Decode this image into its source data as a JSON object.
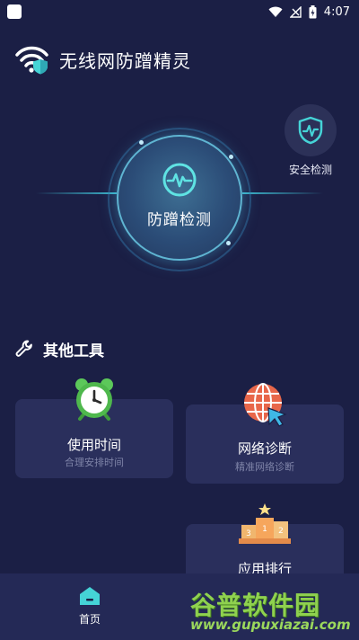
{
  "status_bar": {
    "time": "4:07"
  },
  "app": {
    "title": "无线网防蹭精灵"
  },
  "security_check": {
    "label": "安全检测"
  },
  "scanner": {
    "label": "防蹭检测"
  },
  "tools": {
    "title": "其他工具",
    "items": [
      {
        "title": "使用时间",
        "subtitle": "合理安排时间",
        "icon": "alarm-clock-icon"
      },
      {
        "title": "网络诊断",
        "subtitle": "精准网络诊断",
        "icon": "globe-cursor-icon"
      },
      {
        "title": "应用排行",
        "subtitle": "",
        "icon": "podium-icon"
      }
    ]
  },
  "bottom_nav": {
    "home_label": "首页"
  },
  "watermark": {
    "main": "谷普软件园",
    "url": "www.gupuxiazai.com"
  },
  "colors": {
    "background": "#1b1f45",
    "card": "#2a2f5c",
    "accent": "#45d3d6",
    "subtext": "#7f84a8"
  }
}
